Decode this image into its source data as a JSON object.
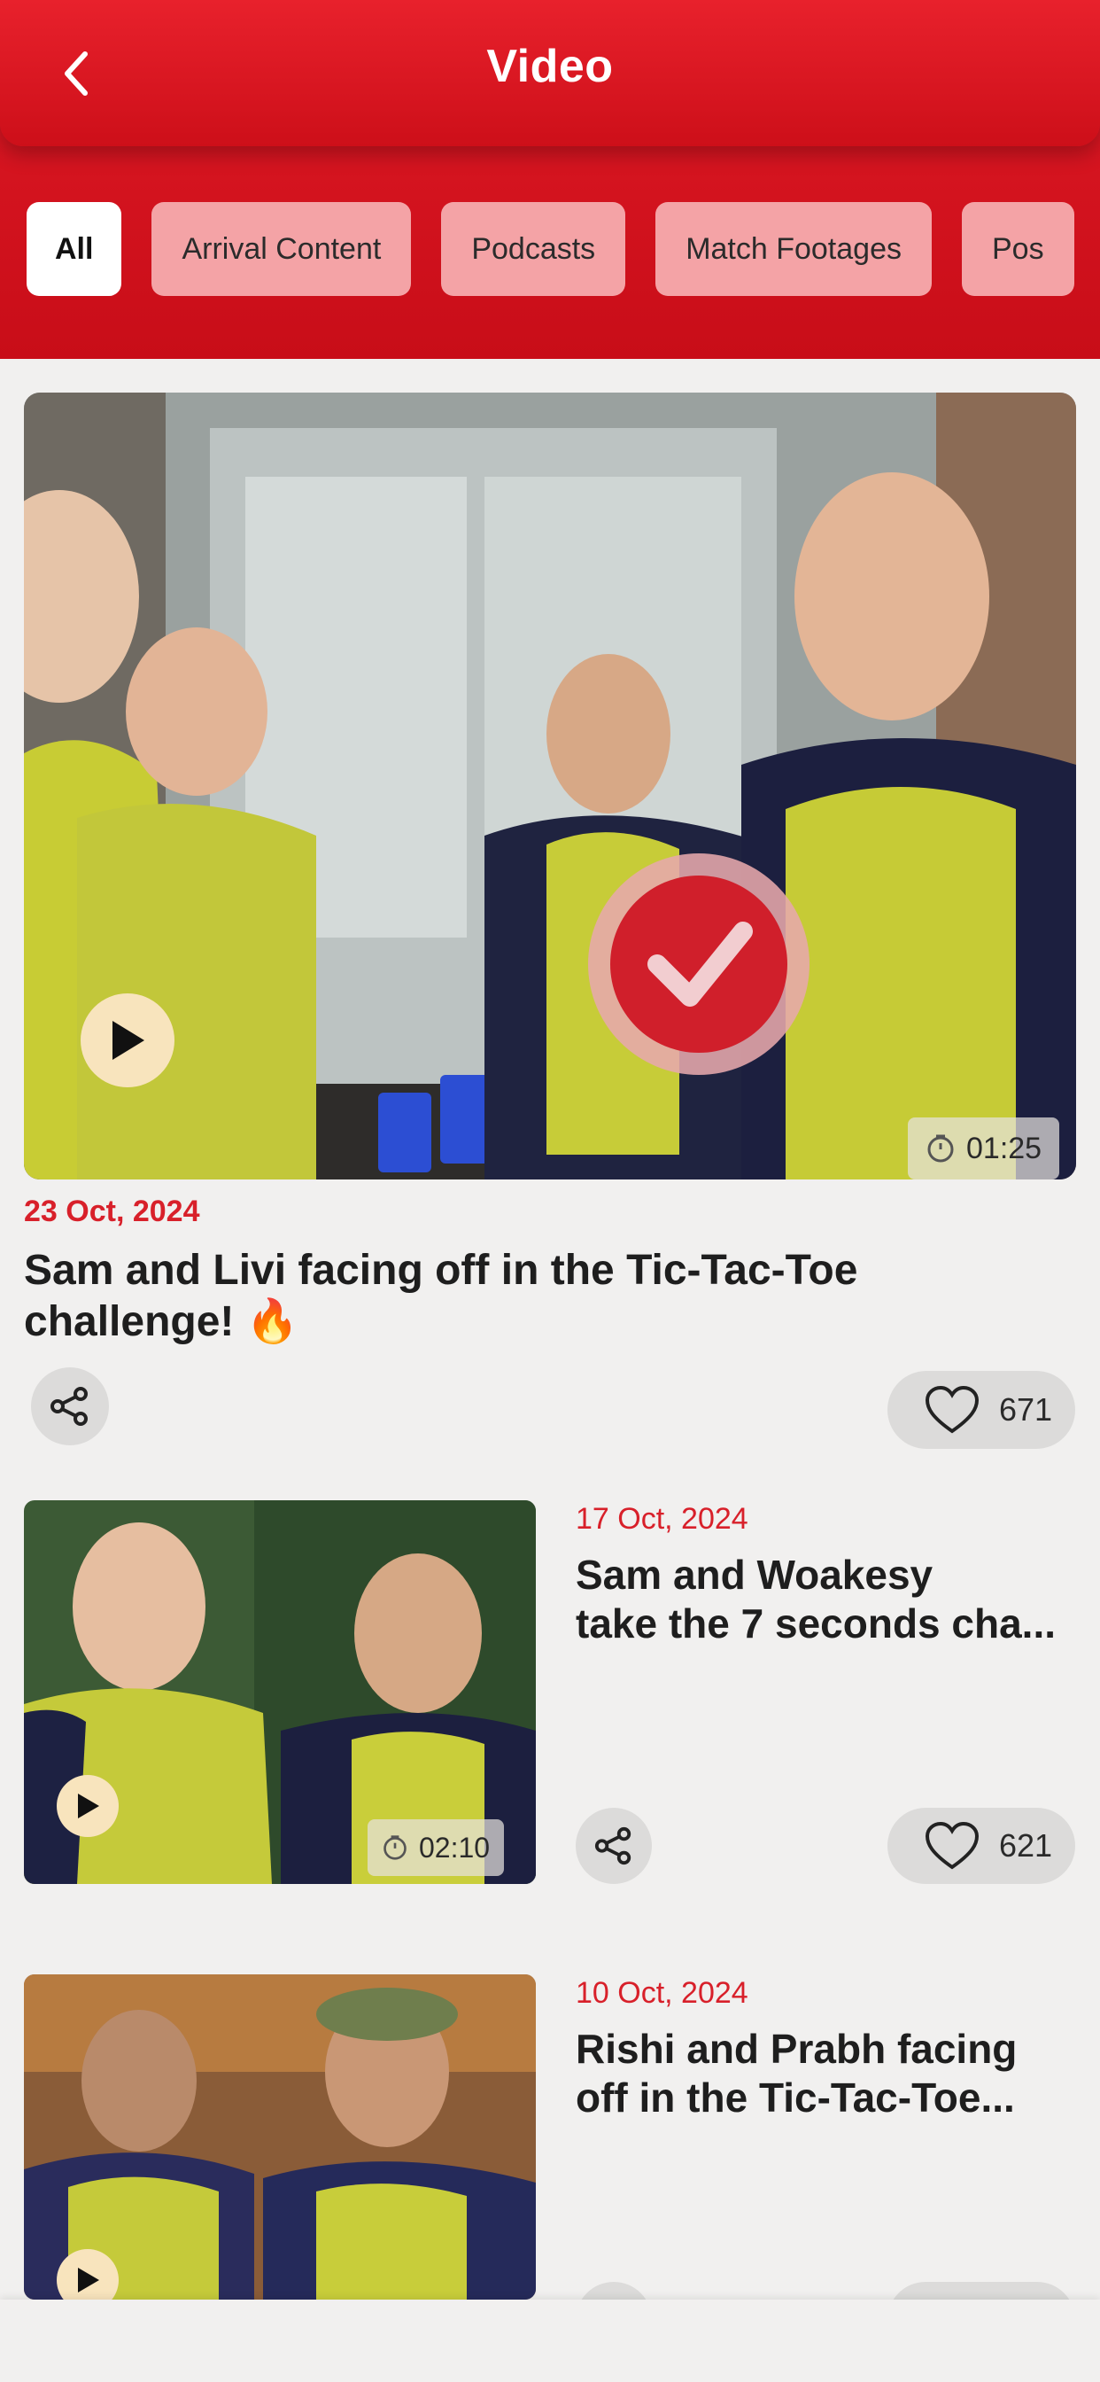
{
  "header": {
    "title": "Video",
    "back_icon": "chevron-left-icon"
  },
  "filters": {
    "chips": [
      "All",
      "Arrival Content",
      "Podcasts",
      "Match Footages",
      "Pos"
    ],
    "active": "All"
  },
  "featured": {
    "date": "23 Oct, 2024",
    "title": "Sam and Livi facing off in the Tic-Tac-Toe challenge! 🔥",
    "duration": "01:25",
    "likes": "671"
  },
  "videos": [
    {
      "date": "17 Oct, 2024",
      "title_line1": "Sam and Woakesy",
      "title_line2": "take the 7 seconds cha...",
      "duration": "02:10",
      "likes": "621"
    },
    {
      "date": "10 Oct, 2024",
      "title_line1": "Rishi and Prabh facing",
      "title_line2": "off in the Tic-Tac-Toe..."
    }
  ],
  "colors": {
    "brand_red": "#d8202a",
    "chip_inactive": "#f4a3a6",
    "play_button": "#f8e4bd"
  }
}
